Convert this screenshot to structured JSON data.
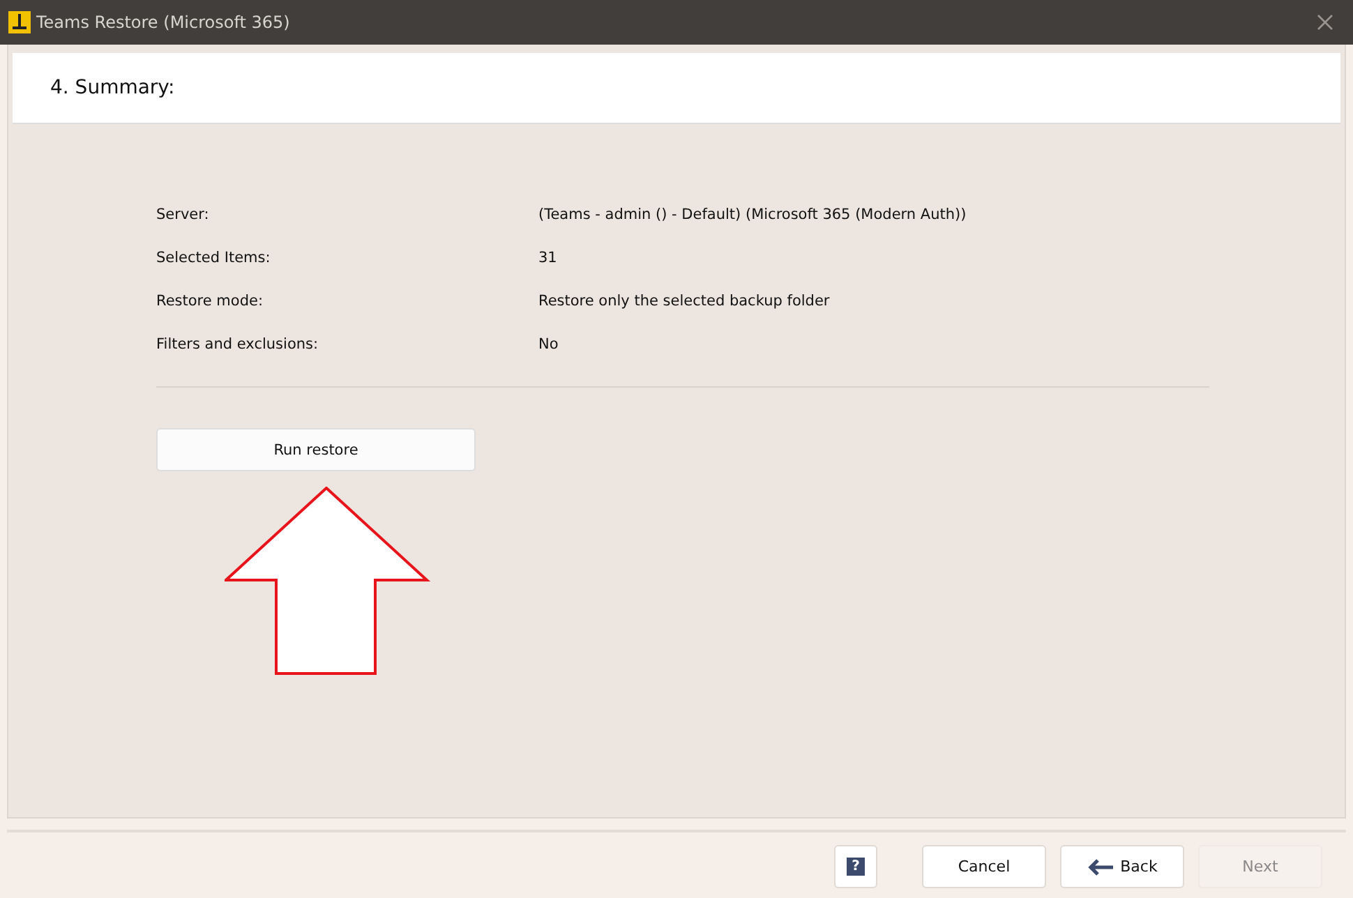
{
  "window": {
    "title": "Teams Restore (Microsoft 365)"
  },
  "step": {
    "heading": "4. Summary:"
  },
  "summary": [
    {
      "label": "Server:",
      "value": "(Teams - admin () - Default) (Microsoft 365 (Modern Auth))"
    },
    {
      "label": "Selected Items:",
      "value": "31"
    },
    {
      "label": "Restore mode:",
      "value": "Restore only the selected backup folder"
    },
    {
      "label": "Filters and exclusions:",
      "value": "No"
    }
  ],
  "action": {
    "label": "Run restore"
  },
  "annotation": {
    "kind": "arrow"
  },
  "footer": {
    "buttons": [
      {
        "kind": "help",
        "label": "?",
        "disabled": false
      },
      {
        "kind": "text",
        "label": "Cancel",
        "disabled": false
      },
      {
        "kind": "back",
        "label": "Back",
        "disabled": false
      },
      {
        "kind": "text",
        "label": "Next",
        "disabled": true
      }
    ]
  }
}
